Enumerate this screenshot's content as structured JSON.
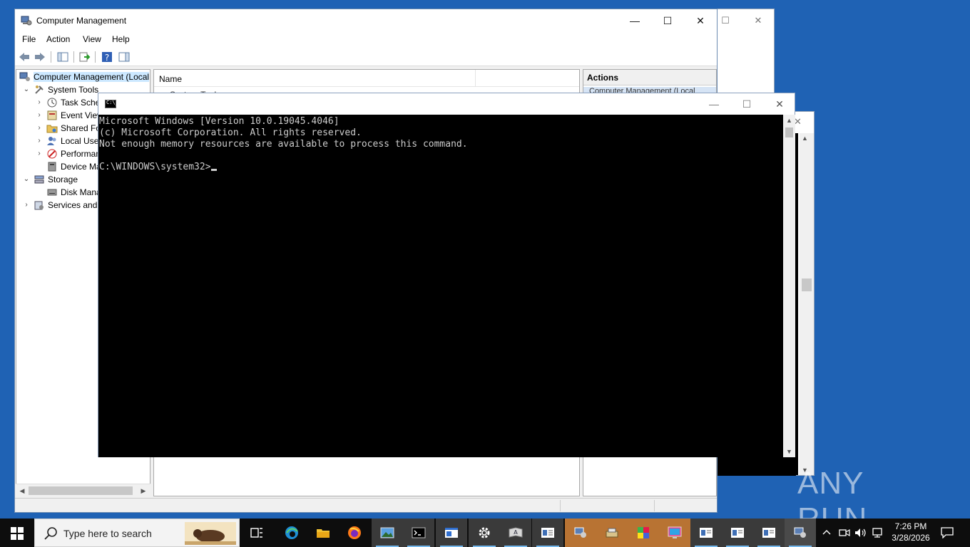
{
  "computer_management": {
    "title": "Computer Management",
    "menu": [
      "File",
      "Action",
      "View",
      "Help"
    ],
    "tree": {
      "root": "Computer Management (Local",
      "system_tools": "System Tools",
      "task_scheduler": "Task Sche",
      "event_viewer": "Event View",
      "shared_folders": "Shared Fo",
      "local_users": "Local User",
      "performance": "Performan",
      "device_manager": "Device Ma",
      "storage": "Storage",
      "disk_management": "Disk Mana",
      "services": "Services and A"
    },
    "center": {
      "column_name": "Name",
      "row_partial": "System Tools"
    },
    "actions": {
      "header": "Actions",
      "item_partial": "Computer Management (Local"
    }
  },
  "console": {
    "lines": [
      "Microsoft Windows [Version 10.0.19045.4046]",
      "(c) Microsoft Corporation. All rights reserved.",
      "Not enough memory resources are available to process this command.",
      "",
      "C:\\WINDOWS\\system32>"
    ]
  },
  "watermark": "ANY RUN",
  "taskbar": {
    "search_placeholder": "Type here to search",
    "time": "7:26 PM",
    "date": "3/28/2026"
  },
  "colors": {
    "desktop": "#1f62b4",
    "taskbar": "#0d0d0d",
    "console_bg": "#000000",
    "console_fg": "#cccccc",
    "selection": "#cce8ff",
    "highlight_app": "#b87333"
  }
}
